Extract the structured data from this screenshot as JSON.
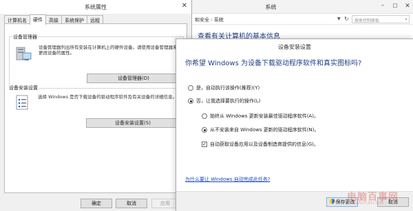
{
  "system_window": {
    "title": "系统",
    "breadcrumb": [
      "和安全",
      "系统"
    ],
    "search_placeholder": "搜索控制面板",
    "heading": "查看有关计算机的基本信息"
  },
  "props": {
    "title": "系统属性",
    "tabs": [
      "计算机名",
      "硬件",
      "高级",
      "系统保护",
      "远程"
    ],
    "active_tab": "硬件",
    "device_manager": {
      "title": "设备管理器",
      "description": "设备管理器列出所有安装在计算机上的硬件设备。请使用设备管理器来更改设备的属性。",
      "button": "设备管理器(D)"
    },
    "device_install": {
      "title": "设备安装设置",
      "description": "选择 Windows 是否下载设备的驱动程序软件及有关设备的详细信息。",
      "button": "设备安装设置(S)"
    },
    "footer": {
      "ok": "确定",
      "cancel": "取消",
      "apply": "应用"
    }
  },
  "dialog": {
    "title": "设备安装设置",
    "question": "你希望 Windows 为设备下载驱动程序软件和真实图标吗?",
    "option_yes": "是，自动执行该操作(推荐)(Y)",
    "option_no": "否，让我选择要执行的操作(L)",
    "sub_option_1": "始终从 Windows 更新安装最佳驱动程序软件(A)。",
    "sub_option_2": "从不安装来自 Windows 更新的驱动程序软件(N)。",
    "sub_option_3": "自动获取设备应用以及设备制造商提供的信息(G)。",
    "link": "为什么要让 Windows 自动完成此任务?",
    "save_button": "保存更改",
    "cancel_button": "取消",
    "selected_option": "no",
    "selected_sub_option": "sub_option_2",
    "sub_option_3_checked": true
  },
  "watermark": {
    "text": "电脑百事网",
    "sub": "WWW.PC841.COM"
  },
  "colors": {
    "heading_blue": "#1e3e8a",
    "link_blue": "#1a46b8",
    "watermark_red": "#d23a3a"
  }
}
